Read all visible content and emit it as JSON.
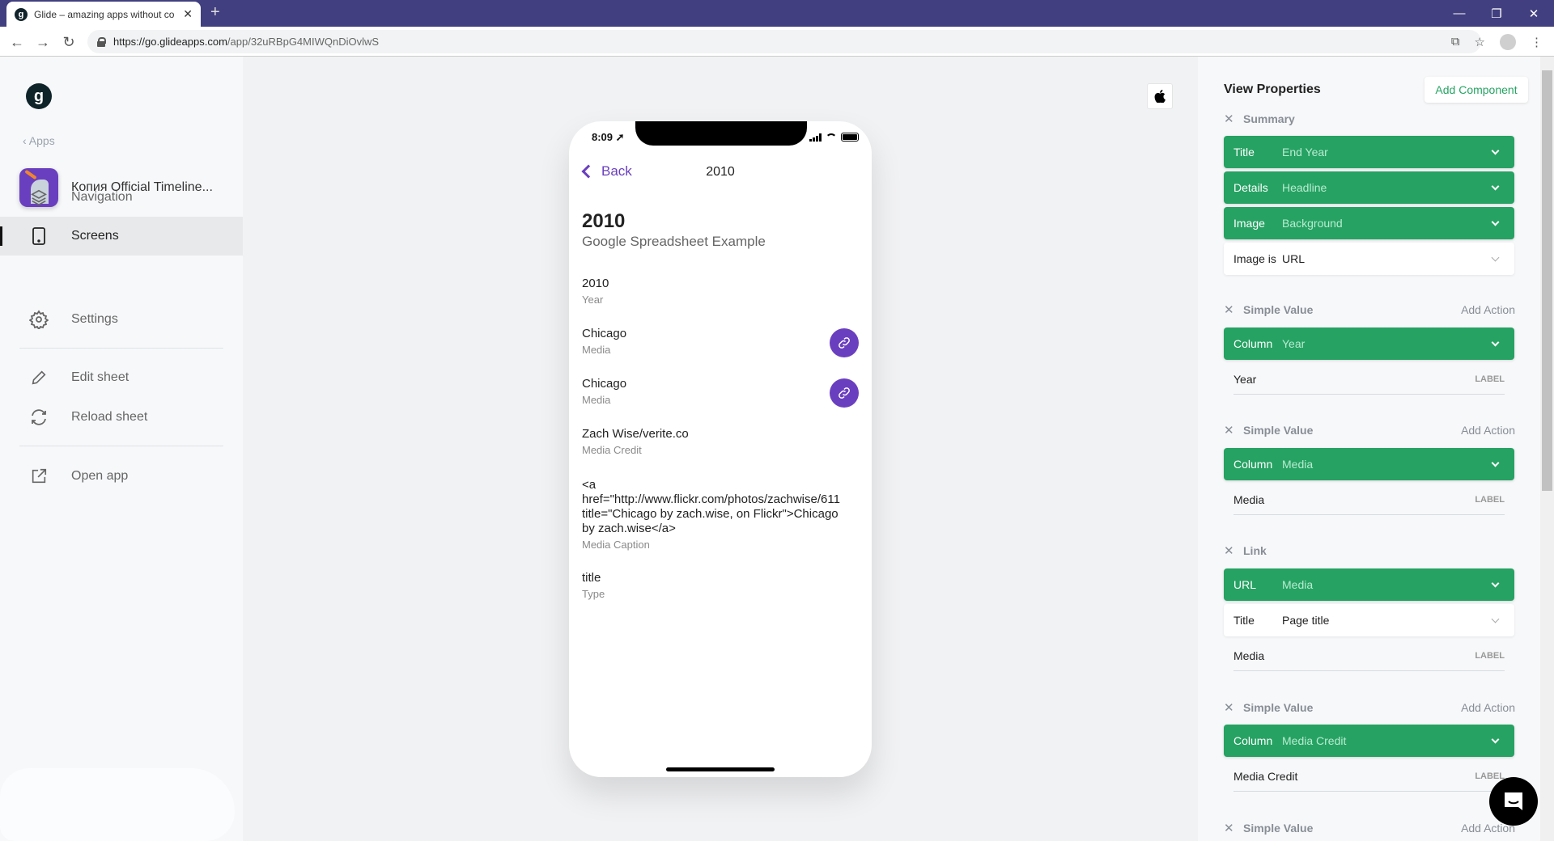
{
  "browser": {
    "tab_title": "Glide – amazing apps without co",
    "tab_favicon": "g",
    "new_tab": "+",
    "url_host": "https://go.glideapps.com",
    "url_path": "/app/32uRBpG4MIWQnDiOvlwS",
    "controls": {
      "minimize": "—",
      "restore": "❐",
      "close": "✕"
    },
    "nav": {
      "back": "←",
      "forward": "→",
      "reload": "↻"
    }
  },
  "sidebar": {
    "logo": "g",
    "apps_link": "‹ Apps",
    "app_name": "Копия Official Timeline...",
    "items": [
      {
        "label": "Navigation",
        "icon": "layers-icon"
      },
      {
        "label": "Screens",
        "icon": "phone-icon",
        "active": true
      },
      {
        "label": "Settings",
        "icon": "gear-icon"
      },
      {
        "label": "Edit sheet",
        "icon": "pencil-icon"
      },
      {
        "label": "Reload sheet",
        "icon": "reload-icon"
      },
      {
        "label": "Open app",
        "icon": "external-link-icon"
      }
    ]
  },
  "phone": {
    "time": "8:09",
    "back_label": "Back",
    "screen_title": "2010",
    "hero_title": "2010",
    "hero_subtitle": "Google Spreadsheet Example",
    "fields": [
      {
        "value": "2010",
        "label": "Year"
      },
      {
        "value": "Chicago",
        "label": "Media",
        "link": true
      },
      {
        "value": "Chicago",
        "label": "Media",
        "link": true
      },
      {
        "value": "Zach Wise/verite.co",
        "label": "Media Credit"
      },
      {
        "value": "<a href=\"http://www.flickr.com/photos/zachwise/611 title=\"Chicago by zach.wise, on Flickr\">Chicago by zach.wise</a>",
        "line1": "<a",
        "line2": "href=\"http://www.flickr.com/photos/zachwise/611",
        "line3": "title=\"Chicago by zach.wise, on Flickr\">Chicago",
        "line4": "by zach.wise</a>",
        "label": "Media Caption"
      },
      {
        "value": "title",
        "label": "Type"
      }
    ]
  },
  "panel": {
    "title": "View Properties",
    "add_component": "Add Component",
    "add_action": "Add Action",
    "label_tag": "LABEL",
    "summary": {
      "name": "Summary",
      "rows": [
        {
          "key": "Title",
          "value": "End Year"
        },
        {
          "key": "Details",
          "value": "Headline"
        },
        {
          "key": "Image",
          "value": "Background"
        }
      ],
      "image_is": {
        "key": "Image is",
        "value": "URL"
      }
    },
    "simple_year": {
      "name": "Simple Value",
      "key": "Column",
      "value": "Year",
      "label": "Year"
    },
    "simple_media": {
      "name": "Simple Value",
      "key": "Column",
      "value": "Media",
      "label": "Media"
    },
    "link": {
      "name": "Link",
      "url_key": "URL",
      "url_value": "Media",
      "title_key": "Title",
      "title_value": "Page title",
      "label": "Media"
    },
    "simple_credit": {
      "name": "Simple Value",
      "key": "Column",
      "value": "Media Credit",
      "label": "Media Credit"
    },
    "simple_next": {
      "name": "Simple Value"
    }
  },
  "colors": {
    "accent_purple": "#6a3fbf",
    "green": "#26a263",
    "browser_bar": "#413f7f"
  }
}
